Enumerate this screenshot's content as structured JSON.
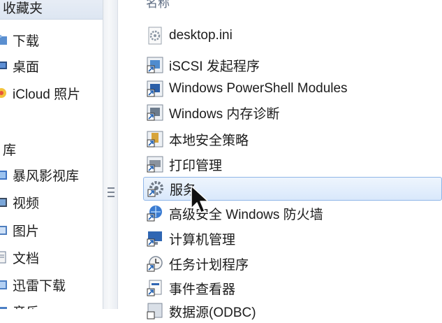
{
  "nav": {
    "favorites_header": "收藏夹",
    "favorites": [
      {
        "label": "下载",
        "icon": "downloads-folder-icon"
      },
      {
        "label": "桌面",
        "icon": "desktop-icon"
      },
      {
        "label": "iCloud 照片",
        "icon": "icloud-photos-icon"
      }
    ],
    "libraries_header": "库",
    "libraries": [
      {
        "label": "暴风影视库",
        "icon": "library-icon"
      },
      {
        "label": "视频",
        "icon": "video-library-icon"
      },
      {
        "label": "图片",
        "icon": "pictures-library-icon"
      },
      {
        "label": "文档",
        "icon": "documents-library-icon"
      },
      {
        "label": "迅雷下载",
        "icon": "download-library-icon"
      },
      {
        "label": "音乐",
        "icon": "music-library-icon"
      }
    ]
  },
  "list": {
    "column_header": "名称",
    "items": [
      {
        "label": "desktop.ini",
        "icon": "settings-file-icon"
      },
      {
        "label": "iSCSI 发起程序",
        "icon": "shortcut-icon"
      },
      {
        "label": "Windows PowerShell Modules",
        "icon": "shortcut-icon"
      },
      {
        "label": "Windows 内存诊断",
        "icon": "shortcut-icon"
      },
      {
        "label": "本地安全策略",
        "icon": "shortcut-icon"
      },
      {
        "label": "打印管理",
        "icon": "shortcut-icon"
      },
      {
        "label": "服务",
        "icon": "services-shortcut-icon"
      },
      {
        "label": "高级安全 Windows 防火墙",
        "icon": "shortcut-icon"
      },
      {
        "label": "计算机管理",
        "icon": "shortcut-icon"
      },
      {
        "label": "任务计划程序",
        "icon": "shortcut-icon"
      },
      {
        "label": "事件查看器",
        "icon": "shortcut-icon"
      },
      {
        "label": "数据源(ODBC)",
        "icon": "shortcut-icon"
      }
    ],
    "selected_index": 6
  },
  "colors": {
    "selection_fill": "#d9e8fb",
    "selection_border": "#8fb6e8",
    "favorites_header_bg": "#e2e9f3"
  }
}
